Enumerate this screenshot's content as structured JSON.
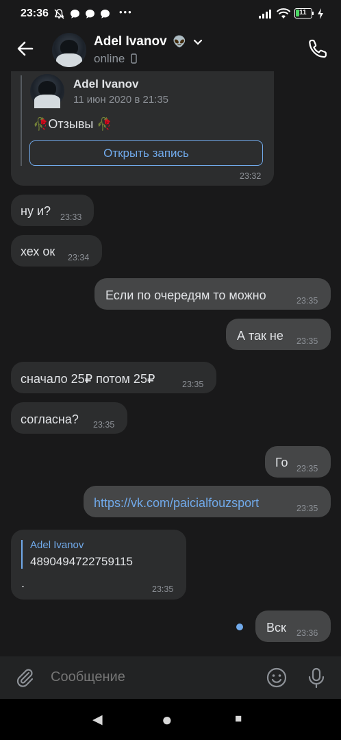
{
  "status_bar": {
    "time": "23:36",
    "dots": "•••",
    "battery": "11"
  },
  "header": {
    "name": "Adel Ivanov",
    "name_emoji": "👽",
    "status": "online"
  },
  "repost": {
    "author": "Adel Ivanov",
    "date": "11 июн 2020 в 21:35",
    "text": "🥀Отзывы 🥀",
    "button": "Открыть запись",
    "time": "23:32"
  },
  "messages": [
    {
      "text": "ну и?",
      "time": "23:33",
      "side": "in"
    },
    {
      "text": "хех ок",
      "time": "23:34",
      "side": "in"
    },
    {
      "text": "Если по очередям то можно",
      "time": "23:35",
      "side": "out"
    },
    {
      "text": "А так не",
      "time": "23:35",
      "side": "out"
    },
    {
      "text": "сначало 25₽ потом 25₽",
      "time": "23:35",
      "side": "in"
    },
    {
      "text": "согласна?",
      "time": "23:35",
      "side": "in"
    },
    {
      "text": "Го",
      "time": "23:35",
      "side": "out"
    },
    {
      "text": "https://vk.com/paicialfouzsport",
      "time": "23:35",
      "side": "out"
    },
    {
      "quote_author": "Adel Ivanov",
      "quote_text": "4890494722759115",
      "text": ".",
      "time": "23:35",
      "side": "in"
    },
    {
      "text": "Вск",
      "time": "23:36",
      "side": "out"
    }
  ],
  "composer": {
    "placeholder": "Сообщение"
  },
  "nav": {
    "back": "◀",
    "home": "●",
    "recents": "■"
  },
  "colors": {
    "background": "#19191a",
    "bubble_in": "#2c2d2e",
    "bubble_out": "#454647",
    "accent": "#71aaeb"
  },
  "icons": [
    "back-arrow-icon",
    "verified-alien-icon",
    "chevron-down-icon",
    "phone-icon",
    "attach-icon",
    "emoji-icon",
    "mic-icon",
    "unread-dot-icon"
  ]
}
